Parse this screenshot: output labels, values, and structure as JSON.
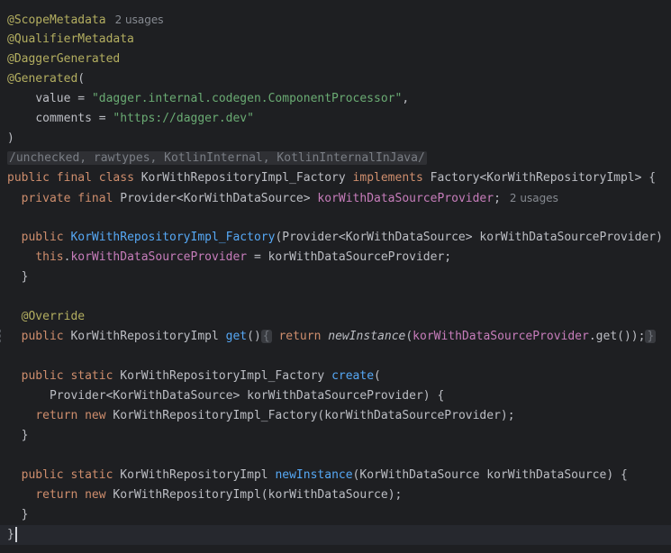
{
  "usages": {
    "scope": "2 usages",
    "field": "2 usages"
  },
  "annotations": {
    "scope_metadata": "@ScopeMetadata",
    "qualifier_metadata": "@QualifierMetadata",
    "dagger_generated": "@DaggerGenerated",
    "generated": "@Generated",
    "override": "@Override"
  },
  "generated_args": {
    "value_name": "value",
    "value_string": "\"dagger.internal.codegen.ComponentProcessor\"",
    "comments_name": "comments",
    "comments_string": "\"https://dagger.dev\""
  },
  "suppress_folded": "/unchecked, rawtypes, KotlinInternal, KotlinInternalInJava/",
  "keywords": {
    "public": "public",
    "final": "final",
    "class": "class",
    "implements": "implements",
    "private": "private",
    "this": "this",
    "return": "return",
    "static": "static",
    "new": "new"
  },
  "identifiers": {
    "class_name": "KorWithRepositoryImpl_Factory",
    "factory_type": "Factory<KorWithRepositoryImpl>",
    "provider_type": "Provider<KorWithDataSource>",
    "field_name": "korWithDataSourceProvider",
    "param_name": "korWithDataSourceProvider",
    "impl_type": "KorWithRepositoryImpl",
    "datasource_type": "KorWithDataSource",
    "datasource_param": "korWithDataSource",
    "get_method": "get",
    "create_method": "create",
    "new_instance_method": "newInstance"
  }
}
